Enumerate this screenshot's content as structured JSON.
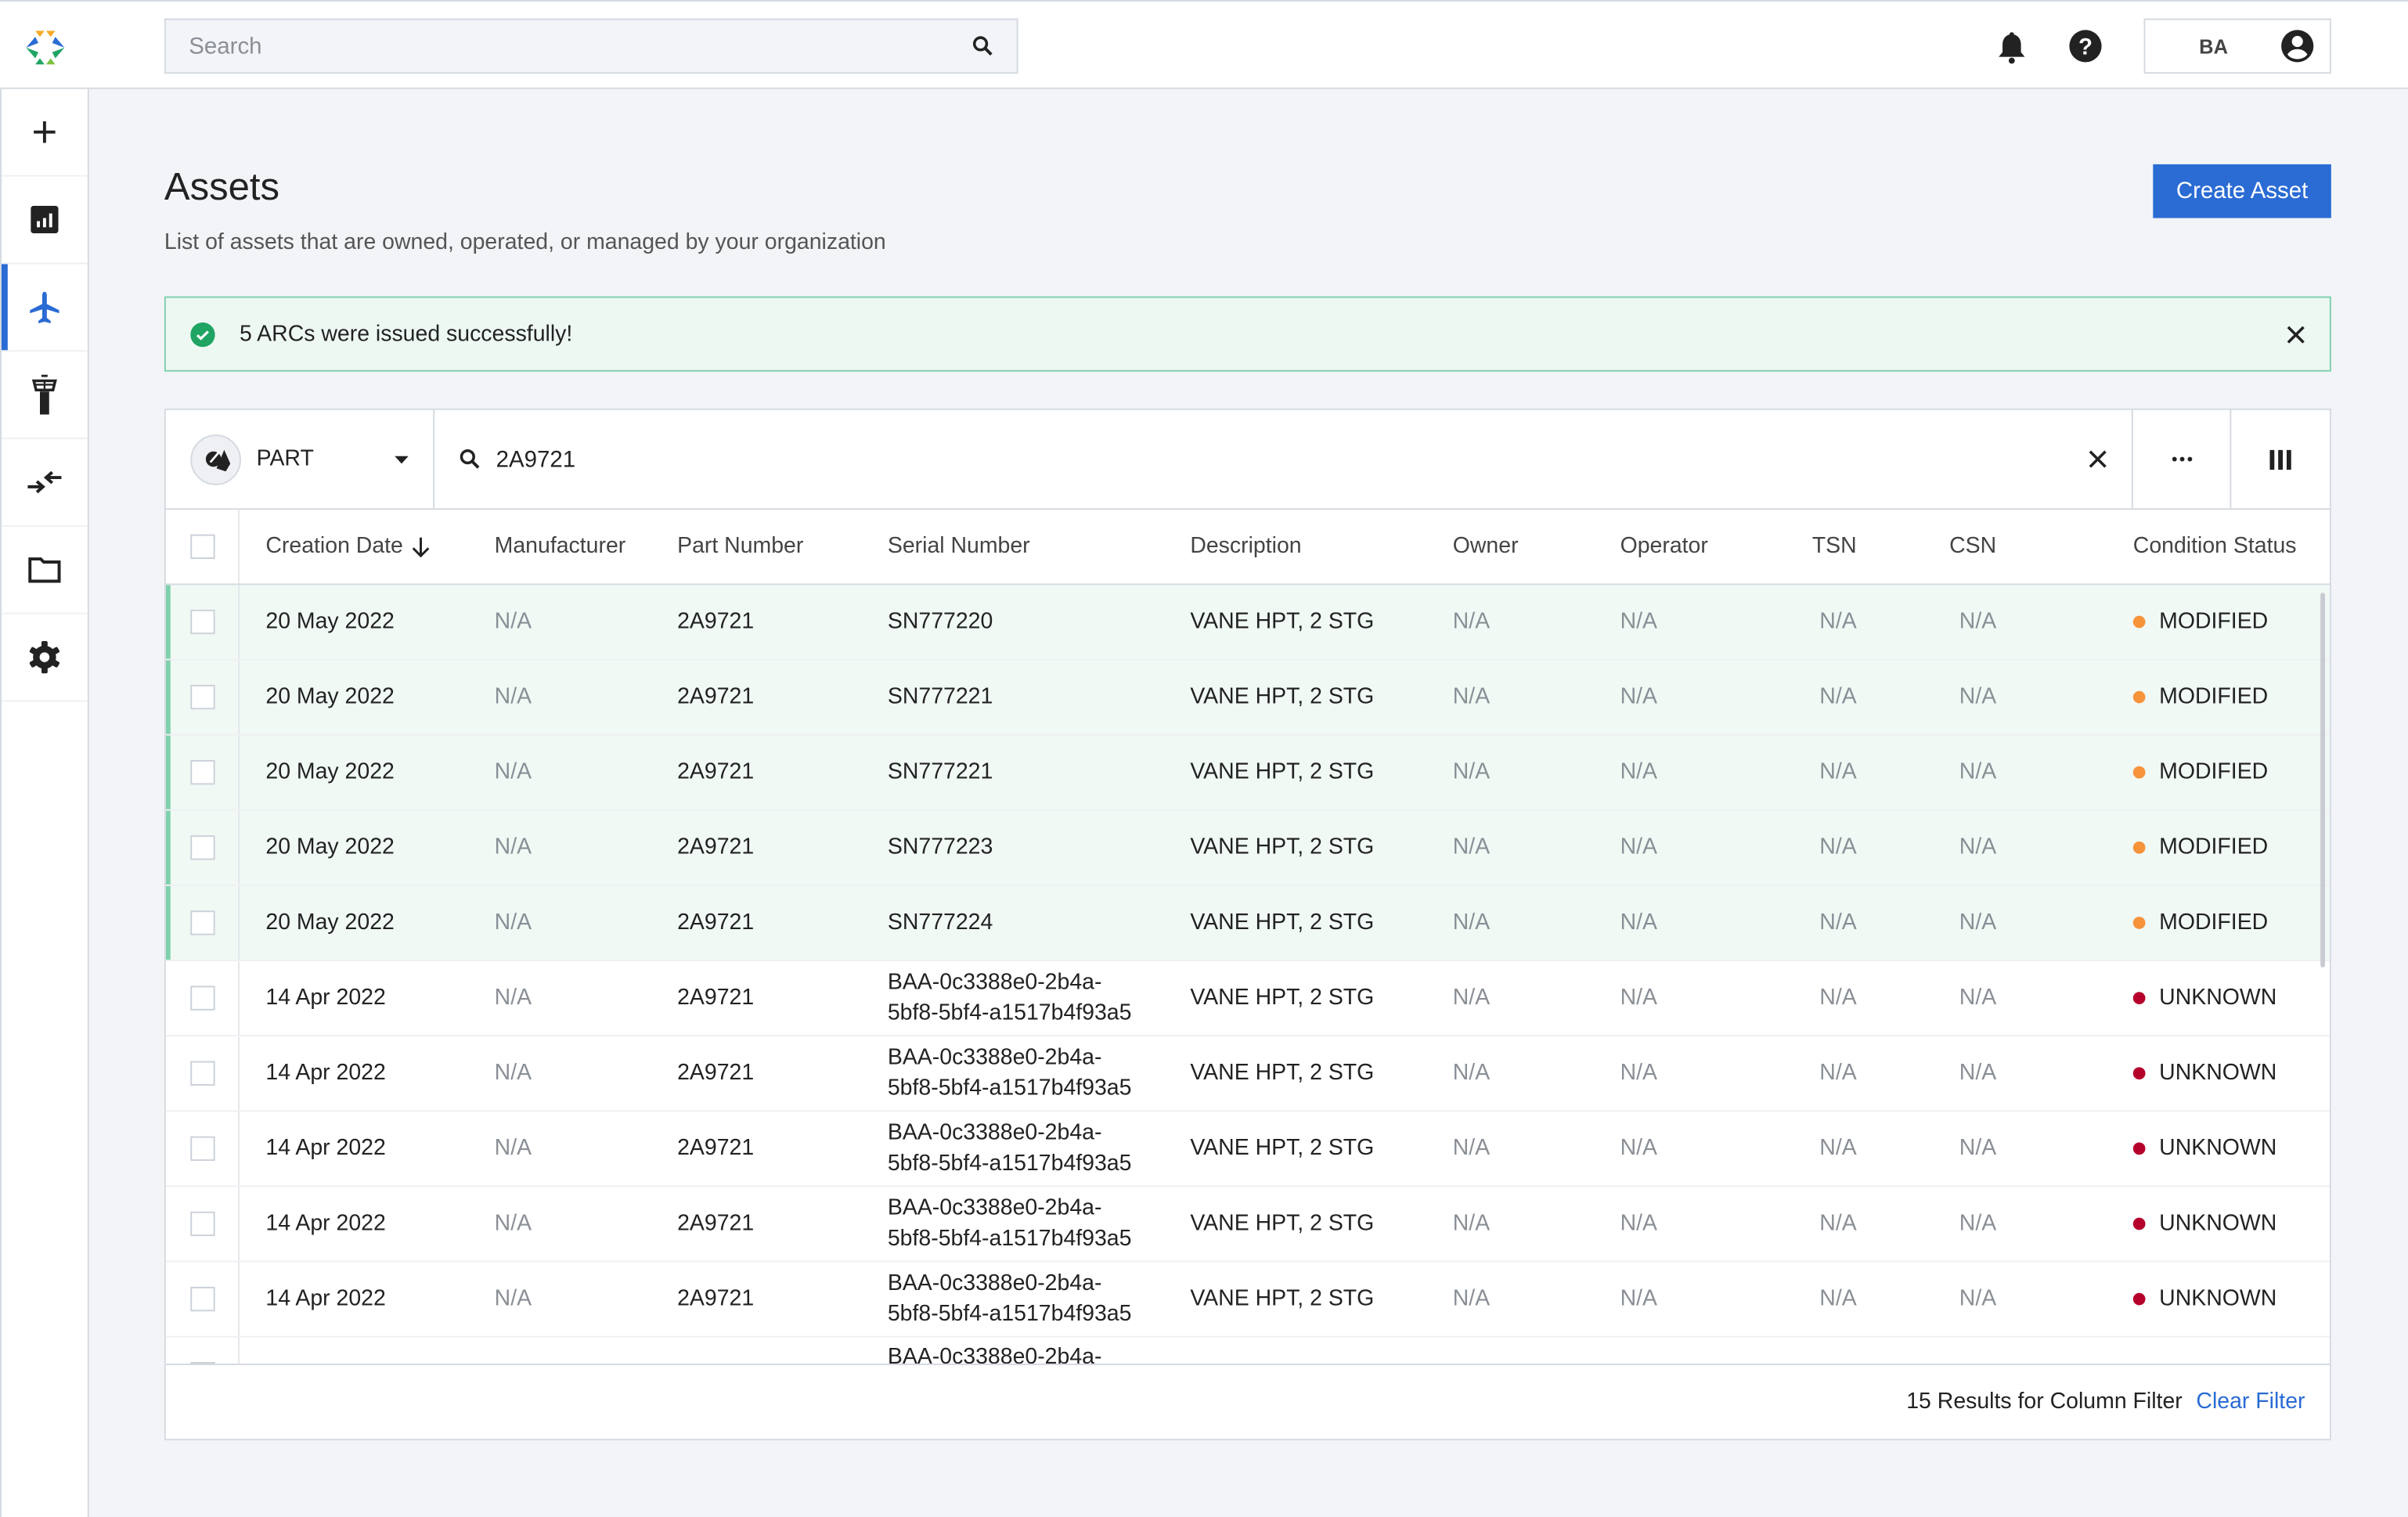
{
  "header": {
    "search_placeholder": "Search",
    "user_initials": "BA"
  },
  "sidebar": {
    "items": [
      {
        "icon": "plus-icon"
      },
      {
        "icon": "chart-icon"
      },
      {
        "icon": "airplane-icon",
        "active": true
      },
      {
        "icon": "control-tower-icon"
      },
      {
        "icon": "compare-arrows-icon"
      },
      {
        "icon": "folder-icon"
      },
      {
        "icon": "gear-icon"
      }
    ]
  },
  "page": {
    "title": "Assets",
    "subtitle": "List of assets that are owned, operated, or managed by your organization",
    "create_label": "Create Asset"
  },
  "alert": {
    "message": "5 ARCs were issued successfully!"
  },
  "filter": {
    "type": "PART",
    "query": "2A9721"
  },
  "table": {
    "columns": [
      "Creation Date",
      "Manufacturer",
      "Part Number",
      "Serial Number",
      "Description",
      "Owner",
      "Operator",
      "TSN",
      "CSN",
      "Condition Status"
    ],
    "sort_column": "Creation Date",
    "sort_direction": "descending",
    "rows": [
      {
        "date": "20 May 2022",
        "manufacturer": "N/A",
        "part": "2A9721",
        "serial": "SN777220",
        "serial2": "",
        "description": "VANE HPT, 2 STG",
        "owner": "N/A",
        "operator": "N/A",
        "tsn": "N/A",
        "csn": "N/A",
        "status": "MODIFIED",
        "highlight": true
      },
      {
        "date": "20 May 2022",
        "manufacturer": "N/A",
        "part": "2A9721",
        "serial": "SN777221",
        "serial2": "",
        "description": "VANE HPT, 2 STG",
        "owner": "N/A",
        "operator": "N/A",
        "tsn": "N/A",
        "csn": "N/A",
        "status": "MODIFIED",
        "highlight": true
      },
      {
        "date": "20 May 2022",
        "manufacturer": "N/A",
        "part": "2A9721",
        "serial": "SN777221",
        "serial2": "",
        "description": "VANE HPT, 2 STG",
        "owner": "N/A",
        "operator": "N/A",
        "tsn": "N/A",
        "csn": "N/A",
        "status": "MODIFIED",
        "highlight": true
      },
      {
        "date": "20 May 2022",
        "manufacturer": "N/A",
        "part": "2A9721",
        "serial": "SN777223",
        "serial2": "",
        "description": "VANE HPT, 2 STG",
        "owner": "N/A",
        "operator": "N/A",
        "tsn": "N/A",
        "csn": "N/A",
        "status": "MODIFIED",
        "highlight": true
      },
      {
        "date": "20 May 2022",
        "manufacturer": "N/A",
        "part": "2A9721",
        "serial": "SN777224",
        "serial2": "",
        "description": "VANE HPT, 2 STG",
        "owner": "N/A",
        "operator": "N/A",
        "tsn": "N/A",
        "csn": "N/A",
        "status": "MODIFIED",
        "highlight": true
      },
      {
        "date": "14 Apr 2022",
        "manufacturer": "N/A",
        "part": "2A9721",
        "serial": "BAA-0c3388e0-2b4a-",
        "serial2": "5bf8-5bf4-a1517b4f93a5",
        "description": "VANE HPT, 2 STG",
        "owner": "N/A",
        "operator": "N/A",
        "tsn": "N/A",
        "csn": "N/A",
        "status": "UNKNOWN",
        "highlight": false
      },
      {
        "date": "14 Apr 2022",
        "manufacturer": "N/A",
        "part": "2A9721",
        "serial": "BAA-0c3388e0-2b4a-",
        "serial2": "5bf8-5bf4-a1517b4f93a5",
        "description": "VANE HPT, 2 STG",
        "owner": "N/A",
        "operator": "N/A",
        "tsn": "N/A",
        "csn": "N/A",
        "status": "UNKNOWN",
        "highlight": false
      },
      {
        "date": "14 Apr 2022",
        "manufacturer": "N/A",
        "part": "2A9721",
        "serial": "BAA-0c3388e0-2b4a-",
        "serial2": "5bf8-5bf4-a1517b4f93a5",
        "description": "VANE HPT, 2 STG",
        "owner": "N/A",
        "operator": "N/A",
        "tsn": "N/A",
        "csn": "N/A",
        "status": "UNKNOWN",
        "highlight": false
      },
      {
        "date": "14 Apr 2022",
        "manufacturer": "N/A",
        "part": "2A9721",
        "serial": "BAA-0c3388e0-2b4a-",
        "serial2": "5bf8-5bf4-a1517b4f93a5",
        "description": "VANE HPT, 2 STG",
        "owner": "N/A",
        "operator": "N/A",
        "tsn": "N/A",
        "csn": "N/A",
        "status": "UNKNOWN",
        "highlight": false
      },
      {
        "date": "14 Apr 2022",
        "manufacturer": "N/A",
        "part": "2A9721",
        "serial": "BAA-0c3388e0-2b4a-",
        "serial2": "5bf8-5bf4-a1517b4f93a5",
        "description": "VANE HPT, 2 STG",
        "owner": "N/A",
        "operator": "N/A",
        "tsn": "N/A",
        "csn": "N/A",
        "status": "UNKNOWN",
        "highlight": false
      },
      {
        "date": "",
        "manufacturer": "",
        "part": "",
        "serial": "BAA-0c3388e0-2b4a-",
        "serial2": "",
        "description": "",
        "owner": "",
        "operator": "",
        "tsn": "",
        "csn": "",
        "status": "",
        "highlight": false
      }
    ]
  },
  "footer": {
    "results_text": "15 Results for Column Filter",
    "clear_label": "Clear Filter"
  },
  "colors": {
    "accent": "#2a6bd4",
    "success": "#1fa463",
    "modified": "#f7933b",
    "unknown": "#b5002b",
    "highlight_bg": "#f1f9f5"
  }
}
